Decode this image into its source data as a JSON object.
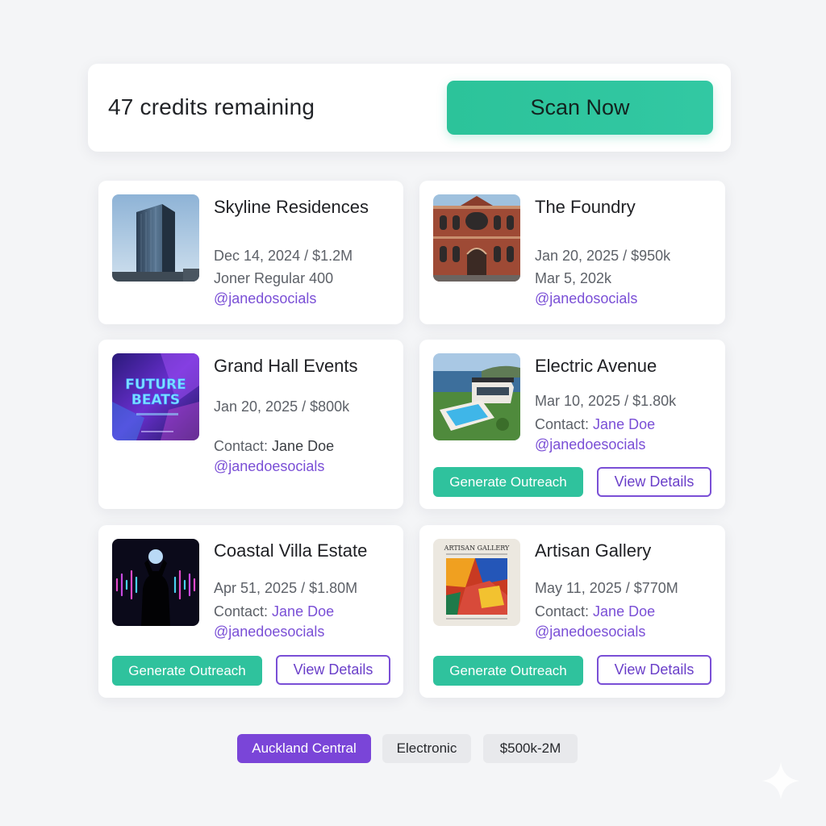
{
  "header": {
    "credits_text": "47 credits remaining",
    "scan_label": "Scan Now"
  },
  "cards": [
    {
      "title": "Skyline Residences",
      "line1": "Dec 14, 2024 / $1.2M",
      "line2": "Joner Regular 400",
      "handle": "@janedosocials",
      "image": "skyscraper-photo"
    },
    {
      "title": "The Foundry",
      "line1": "Jan 20, 2025 / $950k",
      "line2": "Mar 5, 202k",
      "handle": "@janedosocials",
      "image": "brick-building-photo"
    },
    {
      "title": "Grand Hall Events",
      "line1": "Jan 20, 2025 / $800k",
      "contact_prefix": "Contact: ",
      "contact_name": "Jane Doe",
      "handle": "@janedoesocials",
      "image": "future-beats-poster",
      "poster_text_1": "FUTURE",
      "poster_text_2": "BEATS"
    },
    {
      "title": "Electric Avenue",
      "line1": "Mar 10, 2025 / $1.80k",
      "contact_prefix": "Contact: ",
      "contact_name": "Jane Doe",
      "handle": "@janedoesocials",
      "image": "villa-pool-photo",
      "generate_label": "Generate Outreach",
      "view_label": "View Details"
    },
    {
      "title": "Coastal Villa Estate",
      "line1": "Apr 51, 2025 / $1.80M",
      "contact_prefix": "Contact: ",
      "contact_name": "Jane Doe",
      "handle": "@janedoesocials",
      "image": "dj-silhouette-photo",
      "generate_label": "Generate Outreach",
      "view_label": "View Details"
    },
    {
      "title": "Artisan Gallery",
      "line1": "May 11, 2025 / $770M",
      "contact_prefix": "Contact: ",
      "contact_name": "Jane Doe",
      "handle": "@janedoesocials",
      "image": "gallery-poster",
      "poster_text": "ARTISAN GALLERY",
      "generate_label": "Generate Outreach",
      "view_label": "View Details"
    }
  ],
  "filters": [
    {
      "label": "Auckland Central",
      "active": true
    },
    {
      "label": "Electronic",
      "active": false
    },
    {
      "label": "$500k-2M",
      "active": false
    }
  ],
  "colors": {
    "accent_green": "#2fc29d",
    "accent_purple": "#7a4fd6",
    "background": "#f4f5f7"
  },
  "icons": {
    "corner": "sparkle-icon"
  }
}
